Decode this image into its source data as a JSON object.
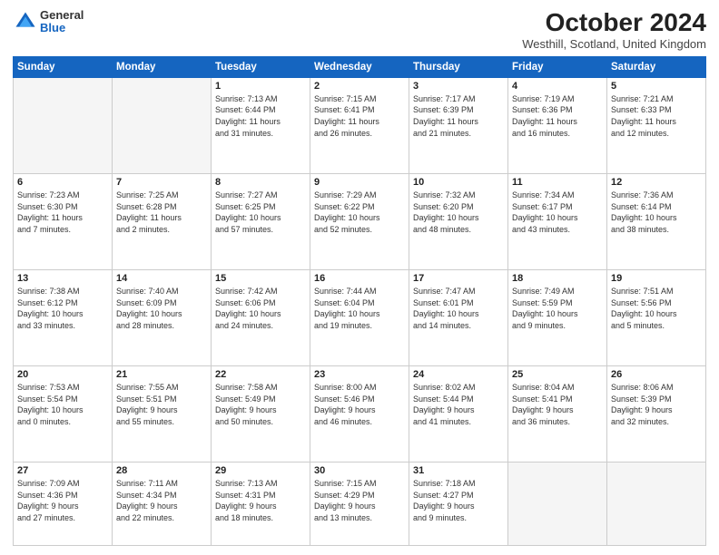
{
  "logo": {
    "general": "General",
    "blue": "Blue"
  },
  "title": "October 2024",
  "subtitle": "Westhill, Scotland, United Kingdom",
  "days_of_week": [
    "Sunday",
    "Monday",
    "Tuesday",
    "Wednesday",
    "Thursday",
    "Friday",
    "Saturday"
  ],
  "weeks": [
    [
      {
        "day": "",
        "detail": ""
      },
      {
        "day": "",
        "detail": ""
      },
      {
        "day": "1",
        "detail": "Sunrise: 7:13 AM\nSunset: 6:44 PM\nDaylight: 11 hours\nand 31 minutes."
      },
      {
        "day": "2",
        "detail": "Sunrise: 7:15 AM\nSunset: 6:41 PM\nDaylight: 11 hours\nand 26 minutes."
      },
      {
        "day": "3",
        "detail": "Sunrise: 7:17 AM\nSunset: 6:39 PM\nDaylight: 11 hours\nand 21 minutes."
      },
      {
        "day": "4",
        "detail": "Sunrise: 7:19 AM\nSunset: 6:36 PM\nDaylight: 11 hours\nand 16 minutes."
      },
      {
        "day": "5",
        "detail": "Sunrise: 7:21 AM\nSunset: 6:33 PM\nDaylight: 11 hours\nand 12 minutes."
      }
    ],
    [
      {
        "day": "6",
        "detail": "Sunrise: 7:23 AM\nSunset: 6:30 PM\nDaylight: 11 hours\nand 7 minutes."
      },
      {
        "day": "7",
        "detail": "Sunrise: 7:25 AM\nSunset: 6:28 PM\nDaylight: 11 hours\nand 2 minutes."
      },
      {
        "day": "8",
        "detail": "Sunrise: 7:27 AM\nSunset: 6:25 PM\nDaylight: 10 hours\nand 57 minutes."
      },
      {
        "day": "9",
        "detail": "Sunrise: 7:29 AM\nSunset: 6:22 PM\nDaylight: 10 hours\nand 52 minutes."
      },
      {
        "day": "10",
        "detail": "Sunrise: 7:32 AM\nSunset: 6:20 PM\nDaylight: 10 hours\nand 48 minutes."
      },
      {
        "day": "11",
        "detail": "Sunrise: 7:34 AM\nSunset: 6:17 PM\nDaylight: 10 hours\nand 43 minutes."
      },
      {
        "day": "12",
        "detail": "Sunrise: 7:36 AM\nSunset: 6:14 PM\nDaylight: 10 hours\nand 38 minutes."
      }
    ],
    [
      {
        "day": "13",
        "detail": "Sunrise: 7:38 AM\nSunset: 6:12 PM\nDaylight: 10 hours\nand 33 minutes."
      },
      {
        "day": "14",
        "detail": "Sunrise: 7:40 AM\nSunset: 6:09 PM\nDaylight: 10 hours\nand 28 minutes."
      },
      {
        "day": "15",
        "detail": "Sunrise: 7:42 AM\nSunset: 6:06 PM\nDaylight: 10 hours\nand 24 minutes."
      },
      {
        "day": "16",
        "detail": "Sunrise: 7:44 AM\nSunset: 6:04 PM\nDaylight: 10 hours\nand 19 minutes."
      },
      {
        "day": "17",
        "detail": "Sunrise: 7:47 AM\nSunset: 6:01 PM\nDaylight: 10 hours\nand 14 minutes."
      },
      {
        "day": "18",
        "detail": "Sunrise: 7:49 AM\nSunset: 5:59 PM\nDaylight: 10 hours\nand 9 minutes."
      },
      {
        "day": "19",
        "detail": "Sunrise: 7:51 AM\nSunset: 5:56 PM\nDaylight: 10 hours\nand 5 minutes."
      }
    ],
    [
      {
        "day": "20",
        "detail": "Sunrise: 7:53 AM\nSunset: 5:54 PM\nDaylight: 10 hours\nand 0 minutes."
      },
      {
        "day": "21",
        "detail": "Sunrise: 7:55 AM\nSunset: 5:51 PM\nDaylight: 9 hours\nand 55 minutes."
      },
      {
        "day": "22",
        "detail": "Sunrise: 7:58 AM\nSunset: 5:49 PM\nDaylight: 9 hours\nand 50 minutes."
      },
      {
        "day": "23",
        "detail": "Sunrise: 8:00 AM\nSunset: 5:46 PM\nDaylight: 9 hours\nand 46 minutes."
      },
      {
        "day": "24",
        "detail": "Sunrise: 8:02 AM\nSunset: 5:44 PM\nDaylight: 9 hours\nand 41 minutes."
      },
      {
        "day": "25",
        "detail": "Sunrise: 8:04 AM\nSunset: 5:41 PM\nDaylight: 9 hours\nand 36 minutes."
      },
      {
        "day": "26",
        "detail": "Sunrise: 8:06 AM\nSunset: 5:39 PM\nDaylight: 9 hours\nand 32 minutes."
      }
    ],
    [
      {
        "day": "27",
        "detail": "Sunrise: 7:09 AM\nSunset: 4:36 PM\nDaylight: 9 hours\nand 27 minutes."
      },
      {
        "day": "28",
        "detail": "Sunrise: 7:11 AM\nSunset: 4:34 PM\nDaylight: 9 hours\nand 22 minutes."
      },
      {
        "day": "29",
        "detail": "Sunrise: 7:13 AM\nSunset: 4:31 PM\nDaylight: 9 hours\nand 18 minutes."
      },
      {
        "day": "30",
        "detail": "Sunrise: 7:15 AM\nSunset: 4:29 PM\nDaylight: 9 hours\nand 13 minutes."
      },
      {
        "day": "31",
        "detail": "Sunrise: 7:18 AM\nSunset: 4:27 PM\nDaylight: 9 hours\nand 9 minutes."
      },
      {
        "day": "",
        "detail": ""
      },
      {
        "day": "",
        "detail": ""
      }
    ]
  ]
}
